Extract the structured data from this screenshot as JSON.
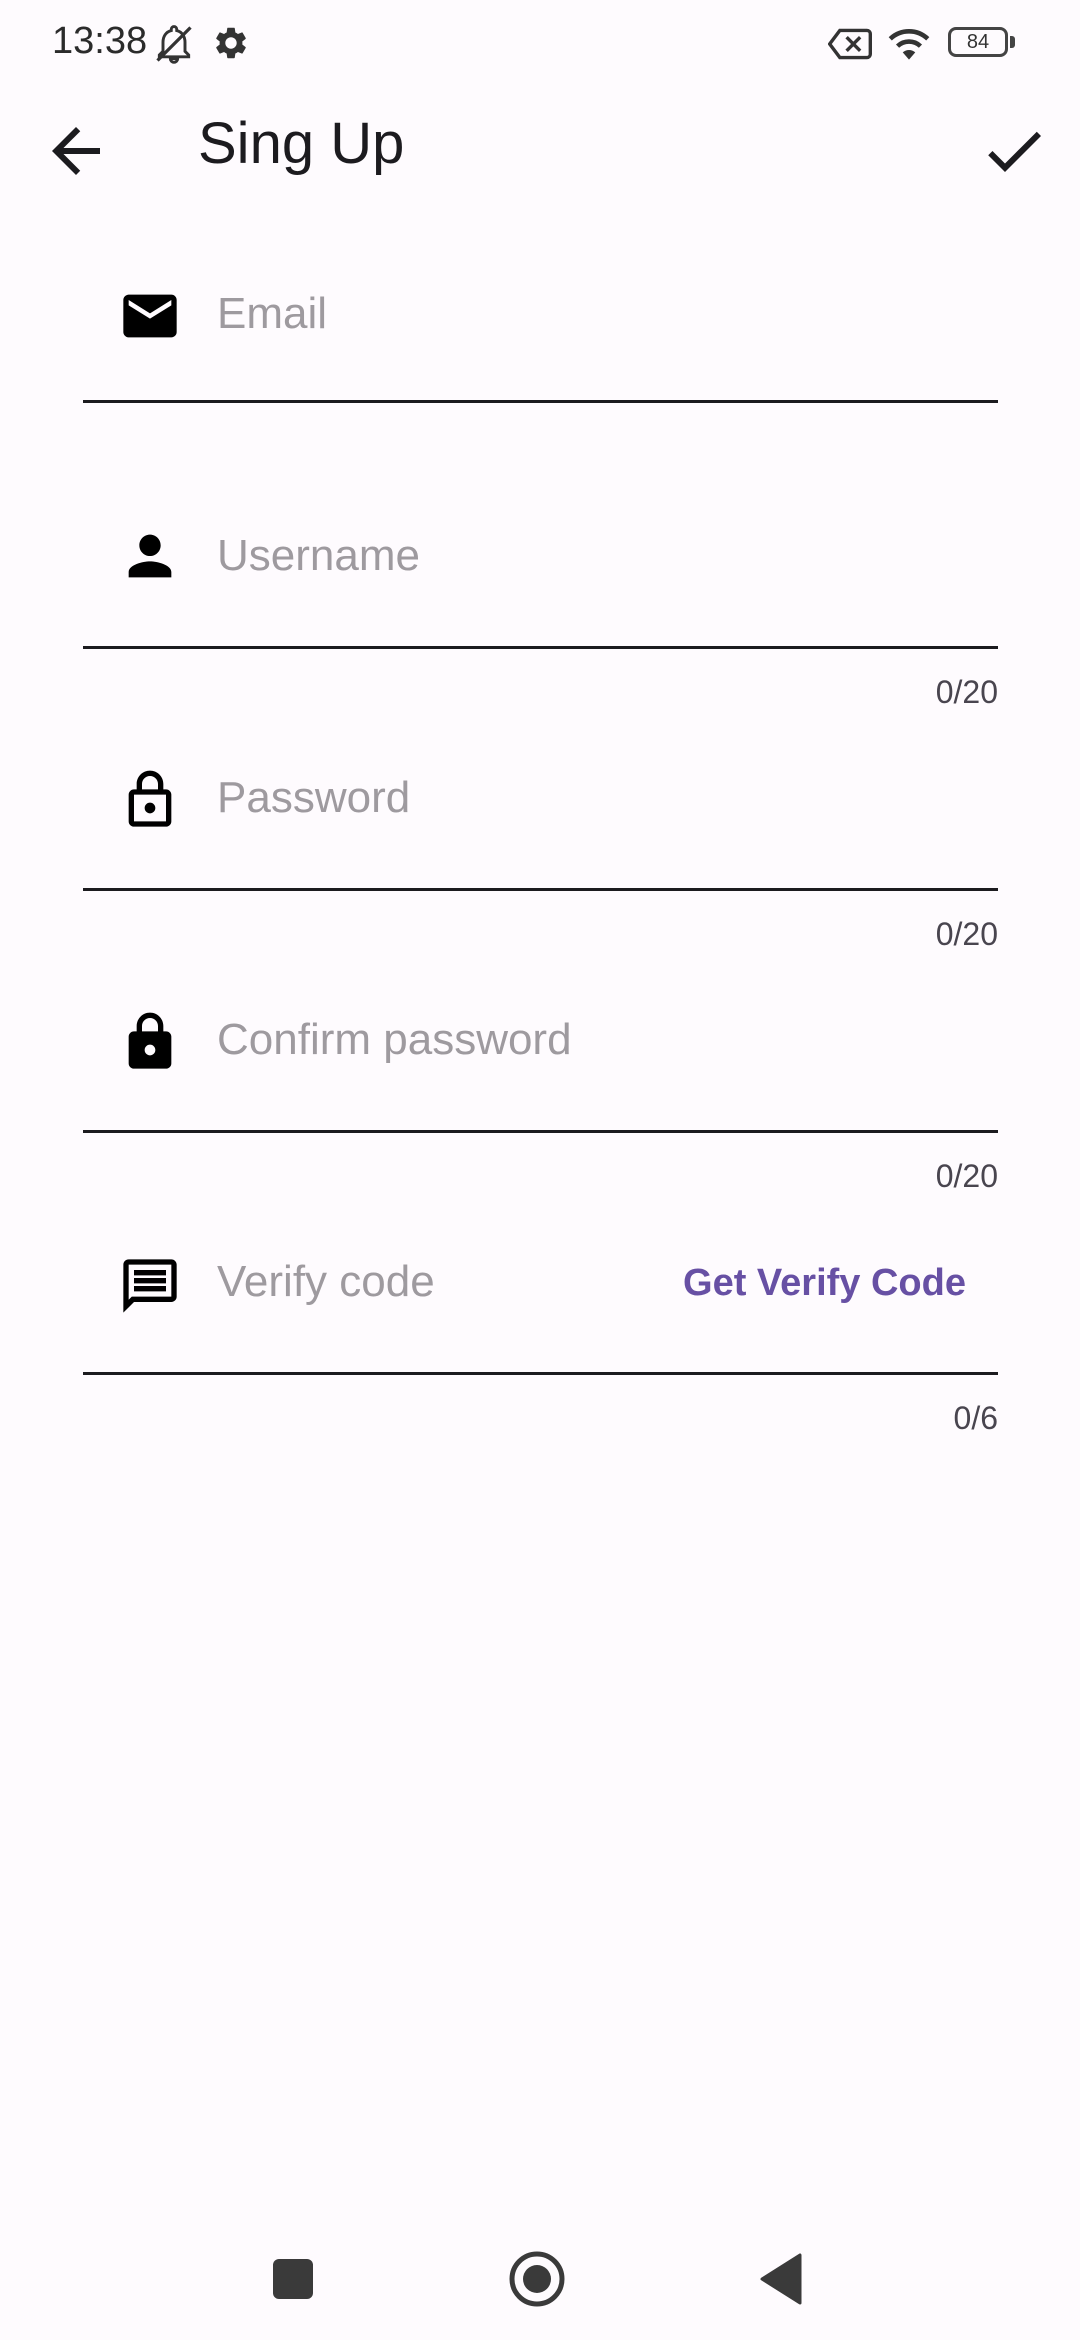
{
  "status_bar": {
    "time": "13:38",
    "battery": "84",
    "icons": [
      "bell-off-icon",
      "gear-icon",
      "no-sim-icon",
      "wifi-icon",
      "battery-icon"
    ]
  },
  "app_bar": {
    "title": "Sing Up",
    "back_icon": "arrow-back-icon",
    "confirm_icon": "check-icon"
  },
  "form": {
    "email": {
      "placeholder": "Email",
      "value": "",
      "icon": "mail-icon"
    },
    "username": {
      "placeholder": "Username",
      "value": "",
      "counter": "0/20",
      "icon": "person-icon"
    },
    "password": {
      "placeholder": "Password",
      "value": "",
      "counter": "0/20",
      "icon": "lock-outline-icon"
    },
    "confirm_password": {
      "placeholder": "Confirm password",
      "value": "",
      "counter": "0/20",
      "icon": "lock-icon"
    },
    "verify_code": {
      "placeholder": "Verify code",
      "value": "",
      "counter": "0/6",
      "icon": "message-icon",
      "action_label": "Get Verify Code"
    }
  },
  "nav_bar": {
    "icons": [
      "recents-icon",
      "home-icon",
      "back-icon"
    ]
  },
  "colors": {
    "background": "#fefbfe",
    "accent": "#6750a4",
    "placeholder": "#9e9a9f",
    "text": "#1c1b1f"
  }
}
